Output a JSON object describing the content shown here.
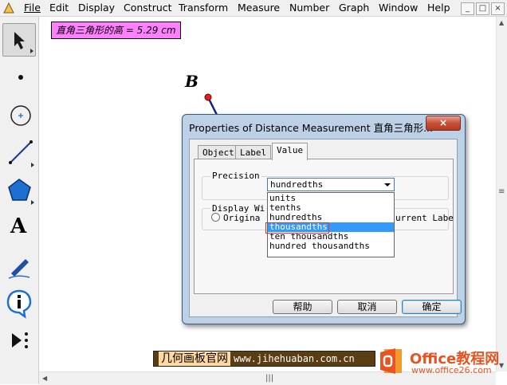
{
  "menu": {
    "items": [
      "File",
      "Edit",
      "Display",
      "Construct",
      "Transform",
      "Measure",
      "Number",
      "Graph",
      "Window",
      "Help"
    ],
    "win_minimize": "_",
    "win_restore": "□",
    "win_close": "×"
  },
  "canvas": {
    "measurement_label": "直角三角形的高 = 5.29 cm",
    "point_label": "B",
    "text_tool_glyph": "A"
  },
  "dialog": {
    "title": "Properties of Distance Measurement 直角三角形...",
    "close": "×",
    "tabs": [
      "Object",
      "Label",
      "Value"
    ],
    "active_tab": "Value",
    "precision_group": "Precision",
    "precision_selected": "hundredths",
    "precision_options": [
      "units",
      "tenths",
      "hundredths",
      "thousandths",
      "ten thousandths",
      "hundred thousandths"
    ],
    "highlighted_option": "thousandths",
    "display_group": "Display Wi",
    "radio_original": "Origina",
    "current_label_text": "urrent Labe",
    "buttons": {
      "help": "帮助",
      "cancel": "取消",
      "ok": "确定"
    }
  },
  "watermark": {
    "cn_text": "几何画板官网",
    "url": "www.jihehuaban.com.cn"
  },
  "office_logo": {
    "name": "Office教程网",
    "url": "www.office26.com"
  },
  "colors": {
    "label_bg": "#ff80ff",
    "selection": "#3399ff",
    "highlight_box": "#e8312a",
    "office_orange": "#e8531f"
  }
}
